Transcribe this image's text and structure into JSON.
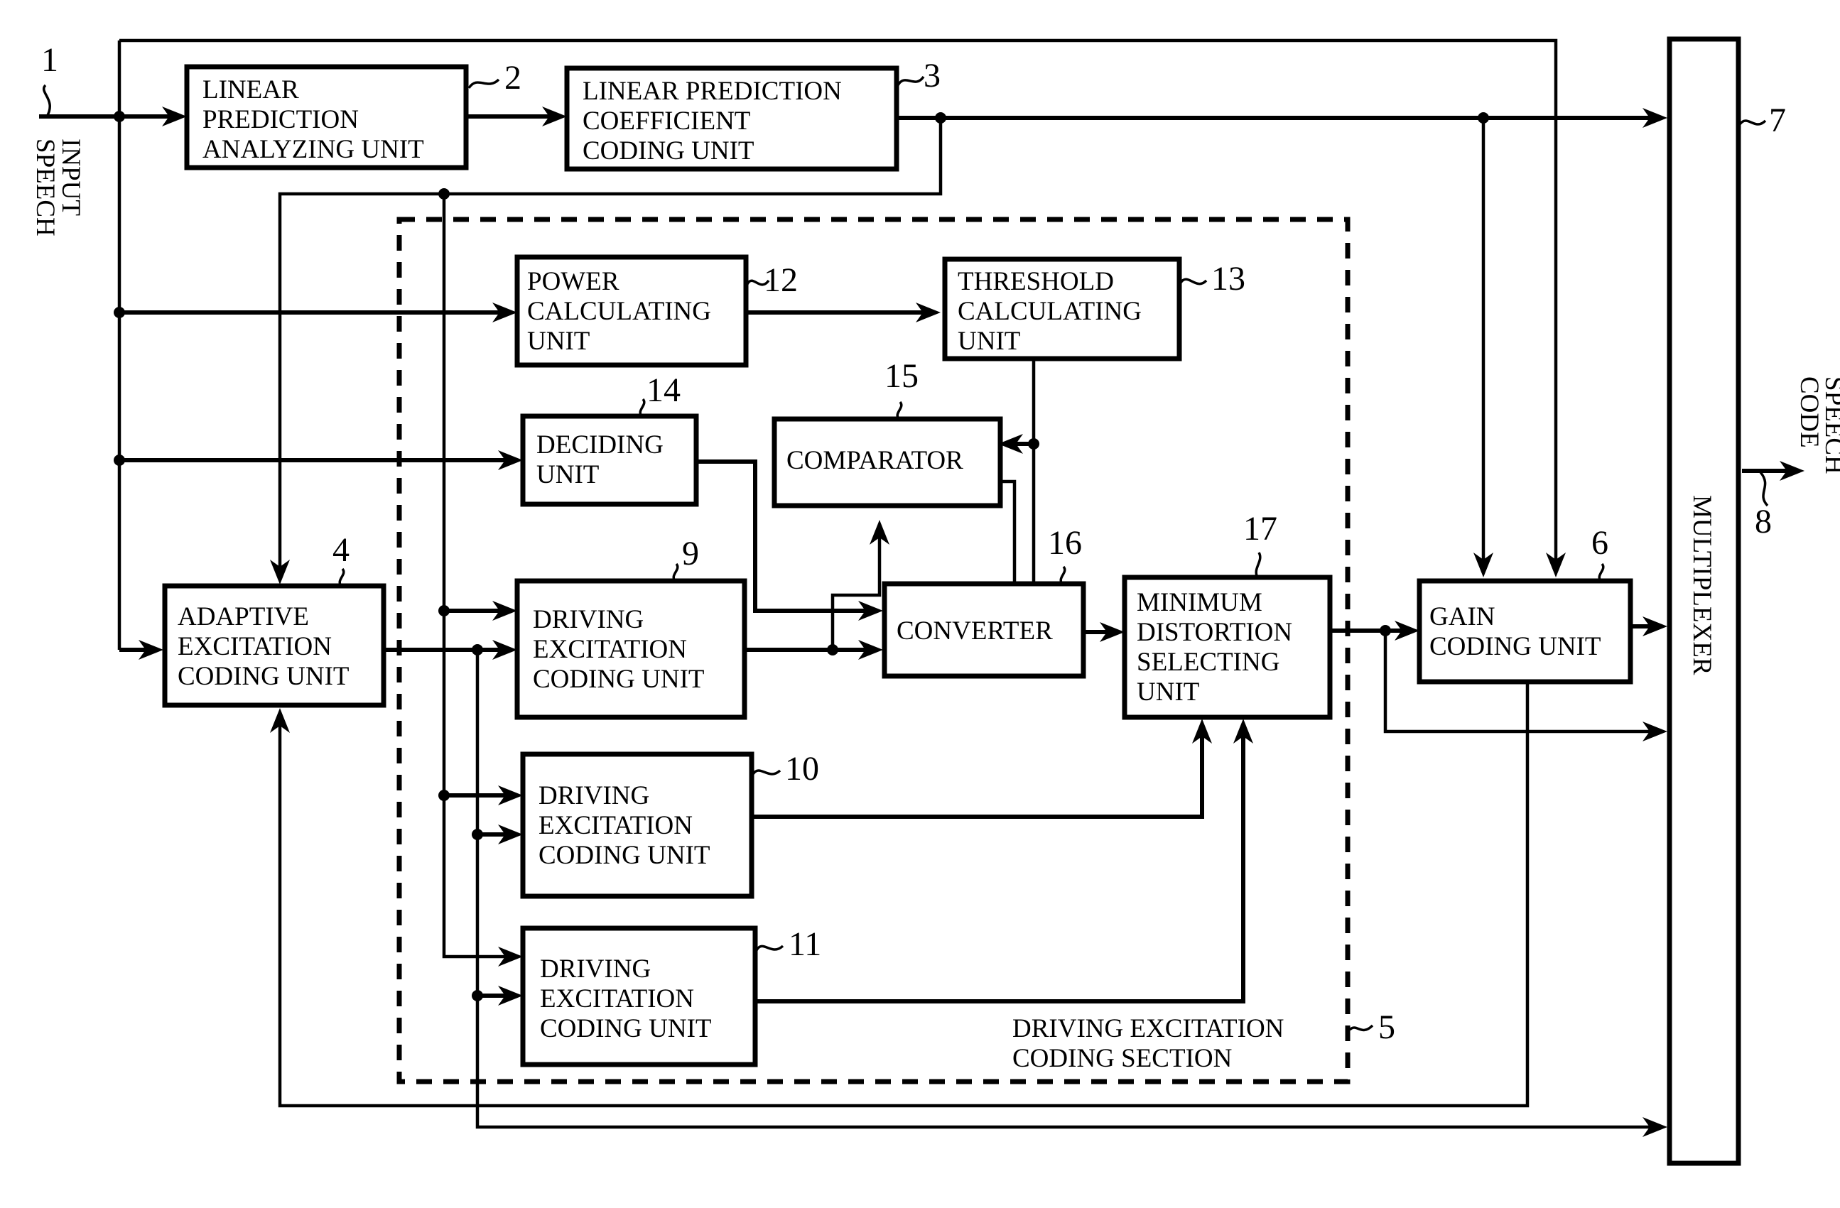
{
  "figure": {
    "input_label": [
      "INPUT",
      "SPEECH"
    ],
    "output_label": [
      "SPEECH",
      "CODE"
    ],
    "section_label": [
      "DRIVING EXCITATION",
      "CODING SECTION"
    ]
  },
  "blocks": {
    "b2": {
      "ref": "2",
      "lines": [
        "LINEAR",
        "PREDICTION",
        "ANALYZING UNIT"
      ]
    },
    "b3": {
      "ref": "3",
      "lines": [
        "LINEAR PREDICTION",
        "COEFFICIENT",
        "CODING UNIT"
      ]
    },
    "b4": {
      "ref": "4",
      "lines": [
        "ADAPTIVE",
        "EXCITATION",
        "CODING UNIT"
      ]
    },
    "b6": {
      "ref": "6",
      "lines": [
        "GAIN",
        "CODING UNIT"
      ]
    },
    "b7": {
      "ref": "7",
      "lines": [
        "MULTIPLEXER"
      ]
    },
    "b9": {
      "ref": "9",
      "lines": [
        "DRIVING",
        "EXCITATION",
        "CODING UNIT"
      ]
    },
    "b10": {
      "ref": "10",
      "lines": [
        "DRIVING",
        "EXCITATION",
        "CODING UNIT"
      ]
    },
    "b11": {
      "ref": "11",
      "lines": [
        "DRIVING",
        "EXCITATION",
        "CODING UNIT"
      ]
    },
    "b12": {
      "ref": "12",
      "lines": [
        "POWER",
        "CALCULATING",
        "UNIT"
      ]
    },
    "b13": {
      "ref": "13",
      "lines": [
        "THRESHOLD",
        "CALCULATING",
        "UNIT"
      ]
    },
    "b14": {
      "ref": "14",
      "lines": [
        "DECIDING",
        "UNIT"
      ]
    },
    "b15": {
      "ref": "15",
      "lines": [
        "COMPARATOR"
      ]
    },
    "b16": {
      "ref": "16",
      "lines": [
        "CONVERTER"
      ]
    },
    "b17": {
      "ref": "17",
      "lines": [
        "MINIMUM",
        "DISTORTION",
        "SELECTING",
        "UNIT"
      ]
    }
  },
  "refs": {
    "input": "1",
    "section": "5",
    "output": "8"
  }
}
